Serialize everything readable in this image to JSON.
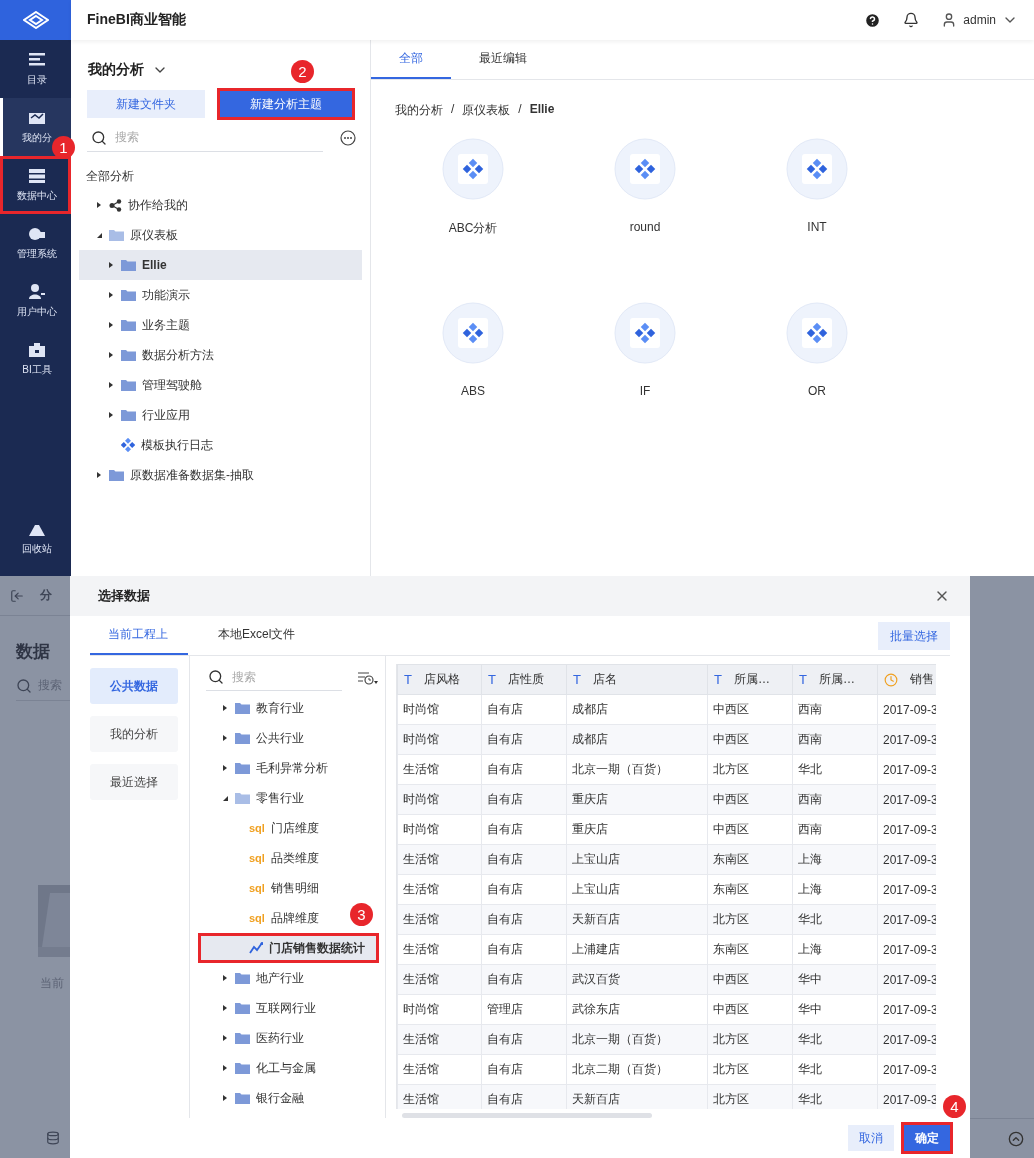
{
  "header": {
    "title": "FineBI商业智能",
    "user": "admin"
  },
  "sidebar": {
    "items": [
      {
        "label": "目录",
        "selected": false,
        "highlighted": false
      },
      {
        "label": "我的分",
        "selected": true,
        "highlighted": false
      },
      {
        "label": "数据中心",
        "selected": false,
        "highlighted": true,
        "callout": "1"
      },
      {
        "label": "管理系统",
        "selected": false,
        "highlighted": false
      },
      {
        "label": "用户中心",
        "selected": false,
        "highlighted": false
      },
      {
        "label": "BI工具",
        "selected": false,
        "highlighted": false
      }
    ],
    "bottom_item": {
      "label": "回收站"
    }
  },
  "analysis_panel": {
    "title": "我的分析",
    "buttons": [
      {
        "label": "新建文件夹",
        "kind": "secondary",
        "highlighted": false
      },
      {
        "label": "新建分析主题",
        "kind": "primary",
        "highlighted": true,
        "callout": "2"
      }
    ],
    "search": {
      "placeholder": "搜索"
    },
    "root": "全部分析",
    "tree": [
      {
        "label": "协作给我的",
        "kind": "share",
        "expanded": false,
        "selected": false
      },
      {
        "label": "原仪表板",
        "kind": "folder",
        "expanded": true,
        "selected": false,
        "children": [
          {
            "label": "Ellie",
            "kind": "folder",
            "expanded": false,
            "selected": true
          },
          {
            "label": "功能演示",
            "kind": "folder",
            "expanded": false,
            "selected": false
          },
          {
            "label": "业务主题",
            "kind": "folder",
            "expanded": false,
            "selected": false
          },
          {
            "label": "数据分析方法",
            "kind": "folder",
            "expanded": false,
            "selected": false
          },
          {
            "label": "管理驾驶舱",
            "kind": "folder",
            "expanded": false,
            "selected": false
          },
          {
            "label": "行业应用",
            "kind": "folder",
            "expanded": false,
            "selected": false
          },
          {
            "label": "模板执行日志",
            "kind": "template",
            "selected": false
          }
        ]
      },
      {
        "label": "原数据准备数据集-抽取",
        "kind": "folder",
        "expanded": false,
        "selected": false
      }
    ]
  },
  "content": {
    "tabs": [
      {
        "label": "全部",
        "selected": true
      },
      {
        "label": "最近编辑",
        "selected": false
      }
    ],
    "breadcrumb": [
      "我的分析",
      "原仪表板",
      "Ellie"
    ],
    "separator": "/",
    "items": [
      {
        "label": "ABC分析"
      },
      {
        "label": "round"
      },
      {
        "label": "INT"
      },
      {
        "label": "ABS"
      },
      {
        "label": "IF"
      },
      {
        "label": "OR"
      }
    ]
  },
  "background_page": {
    "tab": "分",
    "title": "数据",
    "search_placeholder": "搜索",
    "empty_text": "当前"
  },
  "dialog": {
    "title": "选择数据",
    "tabs": [
      {
        "label": "当前工程上",
        "selected": true
      },
      {
        "label": "本地Excel文件",
        "selected": false
      }
    ],
    "batch_button": "批量选择",
    "nav": [
      {
        "label": "公共数据",
        "selected": true
      },
      {
        "label": "我的分析",
        "selected": false
      },
      {
        "label": "最近选择",
        "selected": false
      }
    ],
    "search": {
      "placeholder": "搜索"
    },
    "tree": [
      {
        "label": "教育行业",
        "kind": "folder",
        "expanded": false,
        "selected": false
      },
      {
        "label": "公共行业",
        "kind": "folder",
        "expanded": false,
        "selected": false
      },
      {
        "label": "毛利异常分析",
        "kind": "folder",
        "expanded": false,
        "selected": false
      },
      {
        "label": "零售行业",
        "kind": "folder",
        "expanded": true,
        "selected": false,
        "children": [
          {
            "label": "门店维度",
            "kind": "sql",
            "tag": "sql",
            "selected": false
          },
          {
            "label": "品类维度",
            "kind": "sql",
            "tag": "sql",
            "selected": false
          },
          {
            "label": "销售明细",
            "kind": "sql",
            "tag": "sql",
            "selected": false
          },
          {
            "label": "品牌维度",
            "kind": "sql",
            "tag": "sql",
            "selected": false
          },
          {
            "label": "门店销售数据统计",
            "kind": "analysis",
            "selected": true,
            "highlighted": true,
            "callout": "3"
          }
        ]
      },
      {
        "label": "地产行业",
        "kind": "folder",
        "expanded": false,
        "selected": false
      },
      {
        "label": "互联网行业",
        "kind": "folder",
        "expanded": false,
        "selected": false
      },
      {
        "label": "医药行业",
        "kind": "folder",
        "expanded": false,
        "selected": false
      },
      {
        "label": "化工与金属",
        "kind": "folder",
        "expanded": false,
        "selected": false
      },
      {
        "label": "银行金融",
        "kind": "folder",
        "expanded": false,
        "selected": false
      }
    ],
    "table": {
      "columns": [
        {
          "label": "店风格",
          "kind": "text",
          "mark": "T"
        },
        {
          "label": "店性质",
          "kind": "text",
          "mark": "T"
        },
        {
          "label": "店名",
          "kind": "text",
          "mark": "T"
        },
        {
          "label": "所属…",
          "kind": "text",
          "mark": "T"
        },
        {
          "label": "所属…",
          "kind": "text",
          "mark": "T"
        },
        {
          "label": "销售",
          "kind": "date"
        }
      ],
      "rows": [
        [
          "时尚馆",
          "自有店",
          "成都店",
          "中西区",
          "西南",
          "2017-09-3"
        ],
        [
          "时尚馆",
          "自有店",
          "成都店",
          "中西区",
          "西南",
          "2017-09-3"
        ],
        [
          "生活馆",
          "自有店",
          "北京一期（百货）",
          "北方区",
          "华北",
          "2017-09-3"
        ],
        [
          "时尚馆",
          "自有店",
          "重庆店",
          "中西区",
          "西南",
          "2017-09-3"
        ],
        [
          "时尚馆",
          "自有店",
          "重庆店",
          "中西区",
          "西南",
          "2017-09-3"
        ],
        [
          "生活馆",
          "自有店",
          "上宝山店",
          "东南区",
          "上海",
          "2017-09-3"
        ],
        [
          "生活馆",
          "自有店",
          "上宝山店",
          "东南区",
          "上海",
          "2017-09-3"
        ],
        [
          "生活馆",
          "自有店",
          "天新百店",
          "北方区",
          "华北",
          "2017-09-3"
        ],
        [
          "生活馆",
          "自有店",
          "上浦建店",
          "东南区",
          "上海",
          "2017-09-3"
        ],
        [
          "生活馆",
          "自有店",
          "武汉百货",
          "中西区",
          "华中",
          "2017-09-3"
        ],
        [
          "时尚馆",
          "管理店",
          "武徐东店",
          "中西区",
          "华中",
          "2017-09-3"
        ],
        [
          "生活馆",
          "自有店",
          "北京一期（百货）",
          "北方区",
          "华北",
          "2017-09-3"
        ],
        [
          "生活馆",
          "自有店",
          "北京二期（百货）",
          "北方区",
          "华北",
          "2017-09-3"
        ],
        [
          "生活馆",
          "自有店",
          "天新百店",
          "北方区",
          "华北",
          "2017-09-3"
        ]
      ]
    },
    "buttons": [
      {
        "label": "取消",
        "kind": "secondary",
        "highlighted": false
      },
      {
        "label": "确定",
        "kind": "primary",
        "highlighted": true,
        "callout": "4"
      }
    ]
  }
}
